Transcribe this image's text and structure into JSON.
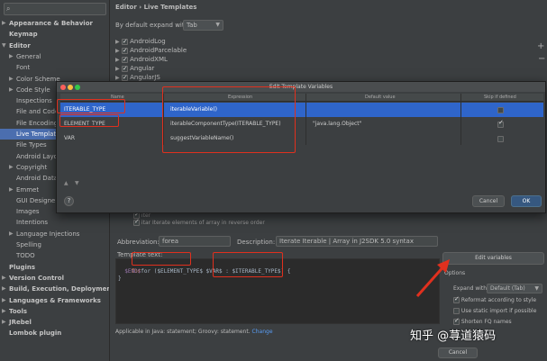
{
  "sidebar": {
    "search_value": "",
    "items": [
      {
        "label": "Appearance & Behavior",
        "arrow": "▶",
        "indent": 0,
        "bold": true
      },
      {
        "label": "Keymap",
        "arrow": "",
        "indent": 0,
        "bold": true
      },
      {
        "label": "Editor",
        "arrow": "▼",
        "indent": 0,
        "bold": true
      },
      {
        "label": "General",
        "arrow": "▶",
        "indent": 1
      },
      {
        "label": "Font",
        "arrow": "",
        "indent": 1
      },
      {
        "label": "Color Scheme",
        "arrow": "▶",
        "indent": 1
      },
      {
        "label": "Code Style",
        "arrow": "▶",
        "indent": 1
      },
      {
        "label": "Inspections",
        "arrow": "",
        "indent": 1
      },
      {
        "label": "File and Code",
        "arrow": "",
        "indent": 1
      },
      {
        "label": "File Encoding",
        "arrow": "",
        "indent": 1
      },
      {
        "label": "Live Templates",
        "arrow": "",
        "indent": 1,
        "selected": true
      },
      {
        "label": "File Types",
        "arrow": "",
        "indent": 1
      },
      {
        "label": "Android Layout",
        "arrow": "",
        "indent": 1
      },
      {
        "label": "Copyright",
        "arrow": "▶",
        "indent": 1
      },
      {
        "label": "Android Data",
        "arrow": "",
        "indent": 1
      },
      {
        "label": "Emmet",
        "arrow": "▶",
        "indent": 1
      },
      {
        "label": "GUI Designer",
        "arrow": "",
        "indent": 1
      },
      {
        "label": "Images",
        "arrow": "",
        "indent": 1
      },
      {
        "label": "Intentions",
        "arrow": "",
        "indent": 1
      },
      {
        "label": "Language Injections",
        "arrow": "▶",
        "indent": 1
      },
      {
        "label": "Spelling",
        "arrow": "",
        "indent": 1
      },
      {
        "label": "TODO",
        "arrow": "",
        "indent": 1
      },
      {
        "label": "Plugins",
        "arrow": "",
        "indent": 0,
        "bold": true
      },
      {
        "label": "Version Control",
        "arrow": "▶",
        "indent": 0,
        "bold": true
      },
      {
        "label": "Build, Execution, Deployment",
        "arrow": "▶",
        "indent": 0,
        "bold": true
      },
      {
        "label": "Languages & Frameworks",
        "arrow": "▶",
        "indent": 0,
        "bold": true
      },
      {
        "label": "Tools",
        "arrow": "▶",
        "indent": 0,
        "bold": true
      },
      {
        "label": "JRebel",
        "arrow": "▶",
        "indent": 0,
        "bold": true
      },
      {
        "label": "Lombok plugin",
        "arrow": "",
        "indent": 0,
        "bold": true
      }
    ]
  },
  "breadcrumb": {
    "part1": "Editor",
    "sep": "›",
    "part2": "Live Templates"
  },
  "expand": {
    "label": "By default expand with",
    "value": "Tab"
  },
  "template_groups": [
    "AndroidLog",
    "AndroidParcelable",
    "AndroidXML",
    "Angular",
    "AngularJS"
  ],
  "dialog": {
    "title": "Edit Template Variables",
    "columns": {
      "name": "Name",
      "expression": "Expression",
      "default": "Default value",
      "skip": "Skip if defined"
    },
    "rows": [
      {
        "name": "ITERABLE_TYPE",
        "expression": "iterableVariable()",
        "default": "",
        "skip": false,
        "selected": true
      },
      {
        "name": "ELEMENT_TYPE",
        "expression": "iterableComponentType(ITERABLE_TYPE)",
        "default": "\"java.lang.Object\"",
        "skip": true
      },
      {
        "name": "VAR",
        "expression": "suggestVariableName()",
        "default": "",
        "skip": false
      }
    ],
    "cancel": "Cancel",
    "ok": "OK",
    "help": "?"
  },
  "partial_rows": [
    "iter",
    "itar  Iterate elements of array in reverse order"
  ],
  "abbreviation": {
    "label": "Abbreviation:",
    "value": "forea"
  },
  "description": {
    "label": "Description:",
    "value": "Iterate Iterable | Array in J2SDK 5.0 syntax"
  },
  "template_text_label": "Template text:",
  "code_lines": [
    "for ($ELEMENT_TYPE$ $VAR$ : $ITERABLE_TYPE$) {",
    "  $END$",
    "}"
  ],
  "edit_variables": "Edit variables",
  "options": {
    "title": "Options",
    "expand_label": "Expand with",
    "expand_value": "Default (Tab)",
    "reformat": "Reformat according to style",
    "static_import": "Use static import if possible",
    "shorten": "Shorten FQ names"
  },
  "applicable": {
    "text": "Applicable in Java: statement; Groovy: statement.",
    "link": "Change"
  },
  "bottom_cancel": "Cancel",
  "watermark": "知乎 @荨道猿码",
  "colors": {
    "selection": "#2f65ca",
    "highlight": "#e0301e",
    "arrow": "#e0301e"
  }
}
